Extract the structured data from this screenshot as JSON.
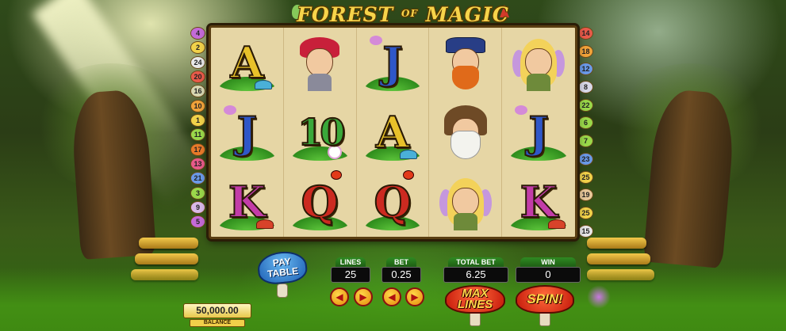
{
  "game": {
    "title_main": "FOREST",
    "title_of": "OF",
    "title_end": "MAGIC"
  },
  "paylines": {
    "left": [
      "4",
      "2",
      "24",
      "20",
      "16",
      "10",
      "1",
      "11",
      "17",
      "13",
      "21",
      "3",
      "9",
      "5"
    ],
    "right": [
      "14",
      "18",
      "12",
      "8",
      "22",
      "6",
      "7",
      "23",
      "25",
      "19",
      "25",
      "15"
    ],
    "colors": {
      "4": "#c46ad8",
      "2": "#f1d24a",
      "24": "#e8e8e8",
      "20": "#e85a4a",
      "16": "#d6d6b0",
      "10": "#f1a33a",
      "1": "#f1d24a",
      "11": "#9ad84a",
      "17": "#e87a2a",
      "13": "#e85a8a",
      "21": "#6a9ae8",
      "3": "#9ad84a",
      "9": "#d8b8e8",
      "5": "#c46ad8",
      "14": "#e85a4a",
      "18": "#f1a33a",
      "12": "#6a9ae8",
      "8": "#d8d8e8",
      "22": "#9ad84a",
      "6": "#9ad84a",
      "7": "#9ad84a",
      "23": "#6a9ae8",
      "25": "#f1d24a",
      "19": "#e8c89a",
      "15": "#e8e8e8"
    }
  },
  "reels": [
    [
      "letter-A",
      "elf-boy",
      "letter-J",
      "leprechaun",
      "fairy"
    ],
    [
      "letter-J",
      "letter-10",
      "letter-A",
      "wizard-gnome",
      "letter-J"
    ],
    [
      "letter-K",
      "letter-Q",
      "letter-Q",
      "fairy",
      "letter-K"
    ]
  ],
  "symbol_text": {
    "letter-A": "A",
    "letter-J": "J",
    "letter-K": "K",
    "letter-Q": "Q",
    "letter-10": "10"
  },
  "controls": {
    "paytable_line1": "PAY",
    "paytable_line2": "TABLE",
    "lines_label": "LINES",
    "lines_value": "25",
    "bet_label": "BET",
    "bet_value": "0.25",
    "total_bet_label": "TOTAL BET",
    "total_bet_value": "6.25",
    "win_label": "WIN",
    "win_value": "0",
    "balance_value": "50,000.00",
    "balance_label": "BALANCE",
    "max_line1": "MAX",
    "max_line2": "LINES",
    "spin_label": "SPIN!"
  },
  "icons": {
    "arrow_left": "◀",
    "arrow_right": "▶"
  }
}
